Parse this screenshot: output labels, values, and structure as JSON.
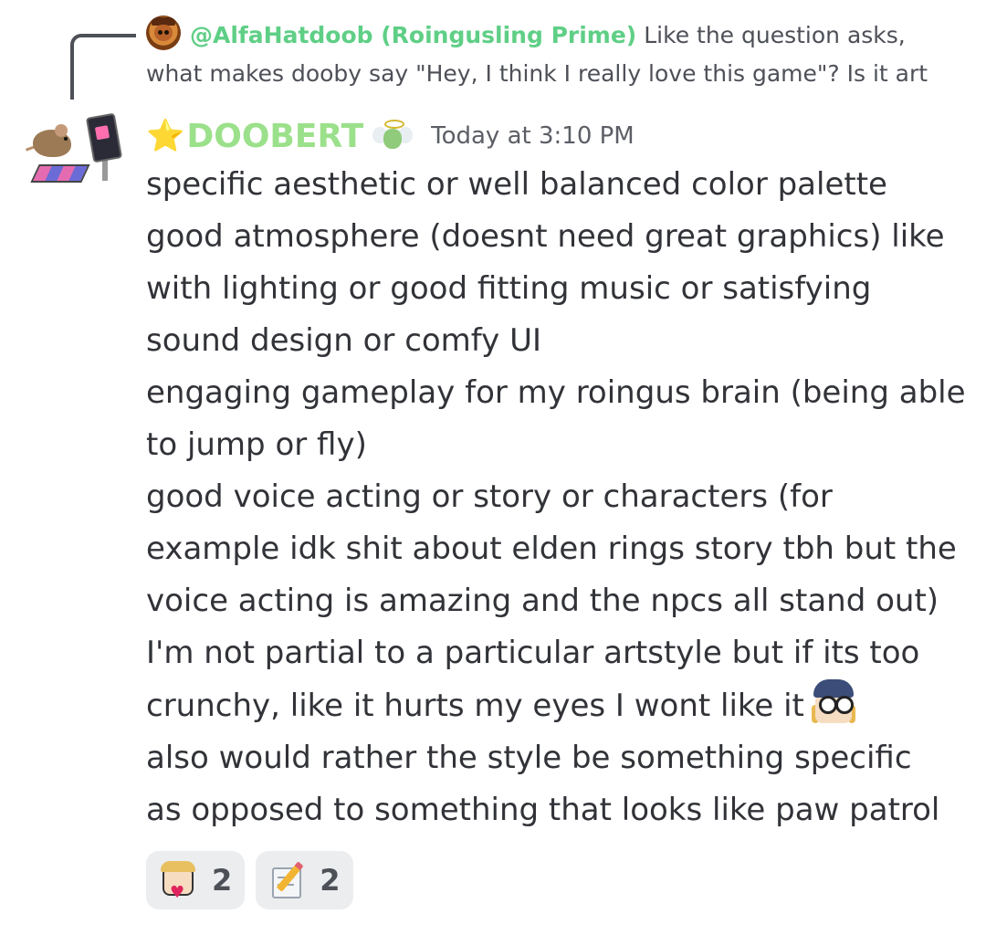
{
  "reply": {
    "author": "@AlfaHatdoob (Roingusling Prime)",
    "text_line1": "Like the question asks,",
    "text_line2": "what makes dooby say \"Hey, I think I really love this game\"? Is it art"
  },
  "message": {
    "star_emoji": "⭐",
    "author": "DOOBERT",
    "timestamp": "Today at 3:10 PM",
    "lines": [
      "specific aesthetic or well balanced color palette",
      "good atmosphere (doesnt need great graphics) like",
      "with lighting or good fitting music or satisfying",
      "sound design or comfy UI",
      "engaging gameplay for my roingus brain (being able",
      "to jump or fly)",
      "good voice acting or story or characters (for",
      "example idk shit about elden rings story tbh but the",
      "voice acting is amazing and the npcs all stand out)",
      "I'm not partial to a particular artstyle but if its too",
      "crunchy, like it hurts my eyes I wont like it",
      "also would rather the style be something specific",
      "as opposed to something that looks like paw patrol"
    ]
  },
  "reactions": [
    {
      "emoji": "goggles-girl-heart-emoji",
      "count": "2"
    },
    {
      "emoji": "memo-pencil-emoji",
      "count": "2"
    }
  ],
  "colors": {
    "username": "#9be08a",
    "reply_author": "#5fcf86",
    "text": "#313338",
    "muted": "#5c5e66",
    "reaction_bg": "#ebedef"
  }
}
